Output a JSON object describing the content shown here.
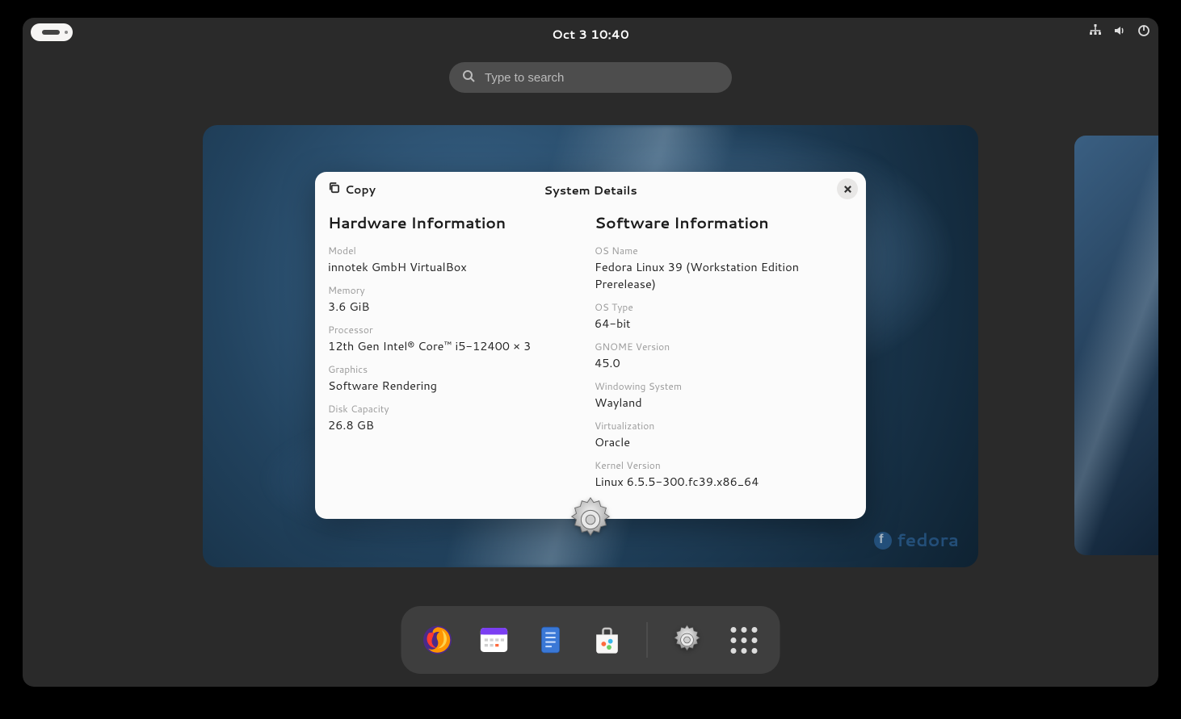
{
  "panel": {
    "clock": "Oct 3  10:40"
  },
  "search": {
    "placeholder": "Type to search"
  },
  "workspace": {
    "watermark": "fedora"
  },
  "dialog": {
    "title": "System Details",
    "copy_label": "Copy",
    "hardware": {
      "heading": "Hardware Information",
      "model_label": "Model",
      "model_value": "innotek GmbH VirtualBox",
      "memory_label": "Memory",
      "memory_value": "3.6 GiB",
      "processor_label": "Processor",
      "processor_value": "12th Gen Intel® Core™ i5-12400 × 3",
      "graphics_label": "Graphics",
      "graphics_value": "Software Rendering",
      "disk_label": "Disk Capacity",
      "disk_value": "26.8 GB"
    },
    "software": {
      "heading": "Software Information",
      "os_name_label": "OS Name",
      "os_name_value": "Fedora Linux 39 (Workstation Edition Prerelease)",
      "os_type_label": "OS Type",
      "os_type_value": "64-bit",
      "gnome_label": "GNOME Version",
      "gnome_value": "45.0",
      "ws_label": "Windowing System",
      "ws_value": "Wayland",
      "virt_label": "Virtualization",
      "virt_value": "Oracle",
      "kernel_label": "Kernel Version",
      "kernel_value": "Linux 6.5.5-300.fc39.x86_64"
    }
  },
  "dock": {
    "items": [
      {
        "name": "firefox"
      },
      {
        "name": "calendar"
      },
      {
        "name": "files"
      },
      {
        "name": "software"
      },
      {
        "name": "settings"
      },
      {
        "name": "apps"
      }
    ]
  }
}
